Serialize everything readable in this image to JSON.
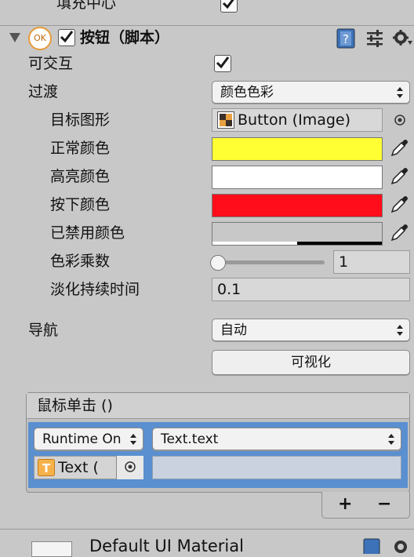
{
  "top_partial": {
    "label": "填充中心"
  },
  "component": {
    "title": "按钮（脚本）",
    "badge": "OK",
    "enabled": true
  },
  "props": {
    "interactable": {
      "label": "可交互",
      "checked": true
    },
    "transition": {
      "label": "过渡",
      "value": "颜色色彩"
    },
    "target_graphic": {
      "label": "目标图形",
      "value": "Button (Image)"
    },
    "normal_color": {
      "label": "正常颜色",
      "hex": "#ffff33"
    },
    "highlighted_color": {
      "label": "高亮颜色",
      "hex": "#ffffff"
    },
    "pressed_color": {
      "label": "按下颜色",
      "hex": "#ff0d1a"
    },
    "disabled_color": {
      "label": "已禁用颜色",
      "hex": "#c8c8c8"
    },
    "color_multiplier": {
      "label": "色彩乘数",
      "value": "1",
      "slider_fraction": 0.0
    },
    "fade_duration": {
      "label": "淡化持续时间",
      "value": "0.1"
    }
  },
  "navigation": {
    "label": "导航",
    "value": "自动",
    "visualize_label": "可视化"
  },
  "event": {
    "header": "鼠标单击 ()",
    "runtime_mode": "Runtime On",
    "function": "Text.text",
    "target_object": "Text (",
    "argument": ""
  },
  "list_controls": {
    "add": "+",
    "remove": "−"
  },
  "next_component": {
    "label": "Default UI Material"
  },
  "colors": {
    "panel_bg": "#c8c8c8",
    "event_row_blue": "#5a8fd0",
    "field_bg": "#d8d8d8"
  },
  "icons": [
    "checkmark-icon",
    "script-ok-icon",
    "help-book-icon",
    "preset-sliders-icon",
    "settings-gear-icon",
    "foldout-arrow-icon",
    "object-picker-icon",
    "eyedropper-icon",
    "text-component-icon",
    "image-asset-icon"
  ]
}
